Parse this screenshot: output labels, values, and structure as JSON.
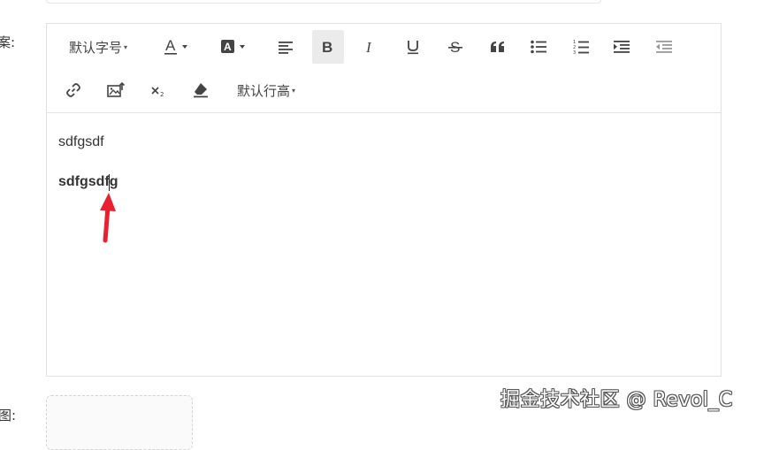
{
  "form": {
    "copy_label": "案:",
    "image_label": "图:"
  },
  "toolbar": {
    "font_size": "默认字号",
    "line_height": "默认行高",
    "row1_icons": [
      "font-size-select",
      "font-color-icon",
      "background-color-icon",
      "align-icon",
      "bold-icon",
      "italic-icon",
      "underline-icon",
      "strikethrough-icon",
      "quote-icon",
      "bullet-list-icon",
      "numbered-list-icon",
      "indent-icon",
      "outdent-icon"
    ],
    "row2_icons": [
      "link-icon",
      "image-icon",
      "subscript-icon",
      "eraser-icon",
      "line-height-select"
    ],
    "active": "bold-icon"
  },
  "editor": {
    "paragraphs": [
      {
        "text": "sdfgsdf",
        "bold": false
      },
      {
        "text": "sdfgsdfg",
        "bold": true
      }
    ]
  },
  "annotation": {
    "arrow_color": "#e8202f"
  },
  "watermark": "掘金技术社区 @ Revol_C"
}
